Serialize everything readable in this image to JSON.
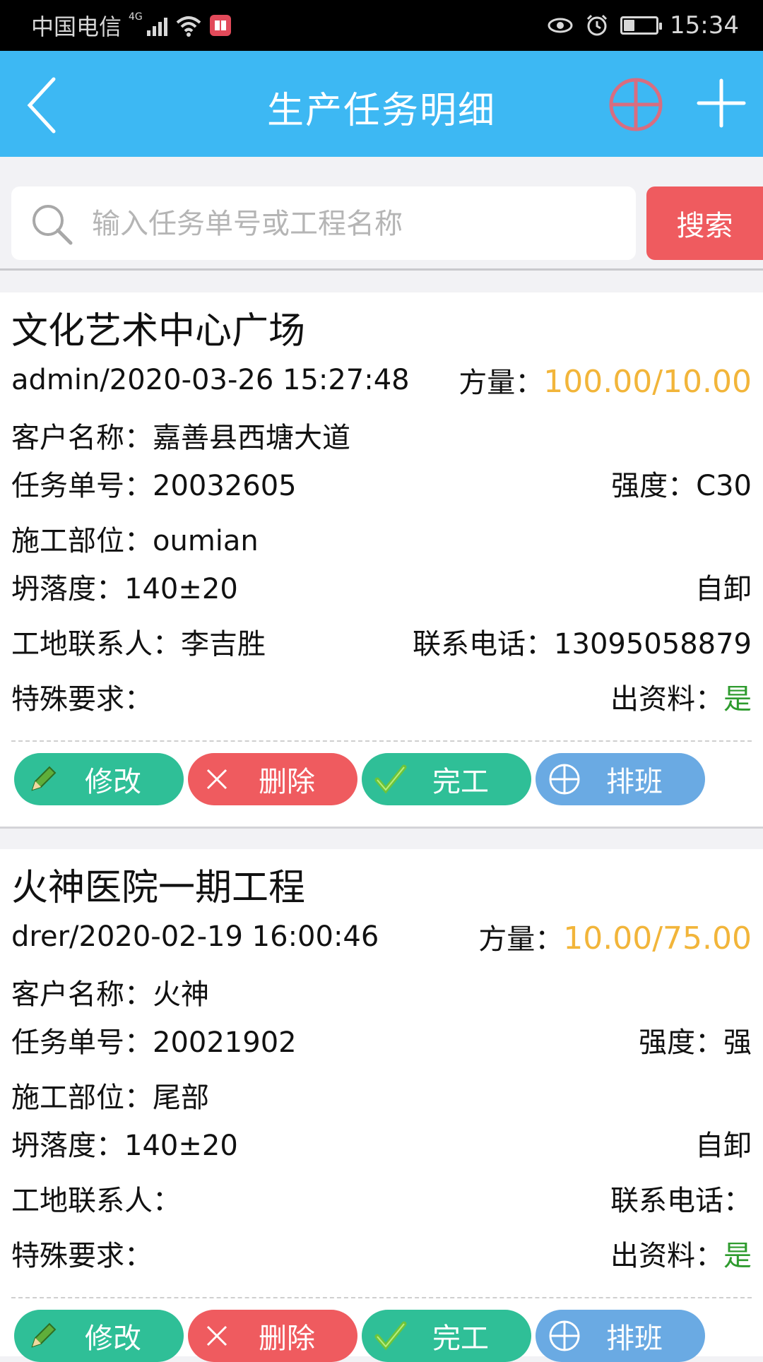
{
  "status_bar": {
    "carrier": "中国电信",
    "network": "4G",
    "time": "15:34",
    "battery_level": 0.35
  },
  "nav": {
    "title": "生产任务明细"
  },
  "search": {
    "placeholder": "输入任务单号或工程名称",
    "value": "",
    "button_label": "搜索"
  },
  "colors": {
    "primary": "#3db8f3",
    "danger": "#ef5b5f",
    "success": "#2fbf97",
    "info": "#6aaae3",
    "amount": "#f2b53a",
    "yes": "#2e9b2e"
  },
  "actions": {
    "edit": "修改",
    "delete": "删除",
    "done": "完工",
    "schedule": "排班"
  },
  "tasks": [
    {
      "project_name": "文化艺术中心广场",
      "creator_time": "admin/2020-03-26 15:27:48",
      "amount_label": "方量：",
      "amount_value": "100.00/10.00",
      "customer_label": "客户名称：",
      "customer_value": "嘉善县西塘大道",
      "task_no_label": "任务单号：",
      "task_no_value": "20032605",
      "strength_label": "强度：",
      "strength_value": "C30",
      "site_part_label": "施工部位：",
      "site_part_value": "oumian",
      "slump_label": "坍落度：",
      "slump_value": "140±20",
      "unload_mode": "自卸",
      "contact_label": "工地联系人：",
      "contact_value": "李吉胜",
      "phone_label": "联系电话：",
      "phone_value": "13095058879",
      "special_label": "特殊要求：",
      "special_value": "",
      "docs_label": "出资料：",
      "docs_value": "是"
    },
    {
      "project_name": "火神医院一期工程",
      "creator_time": "drer/2020-02-19 16:00:46",
      "amount_label": "方量：",
      "amount_value": "10.00/75.00",
      "customer_label": "客户名称：",
      "customer_value": "火神",
      "task_no_label": "任务单号：",
      "task_no_value": "20021902",
      "strength_label": "强度：",
      "strength_value": "强",
      "site_part_label": "施工部位：",
      "site_part_value": "尾部",
      "slump_label": "坍落度：",
      "slump_value": "140±20",
      "unload_mode": "自卸",
      "contact_label": "工地联系人：",
      "contact_value": "",
      "phone_label": "联系电话：",
      "phone_value": "",
      "special_label": "特殊要求：",
      "special_value": "",
      "docs_label": "出资料：",
      "docs_value": "是"
    }
  ]
}
